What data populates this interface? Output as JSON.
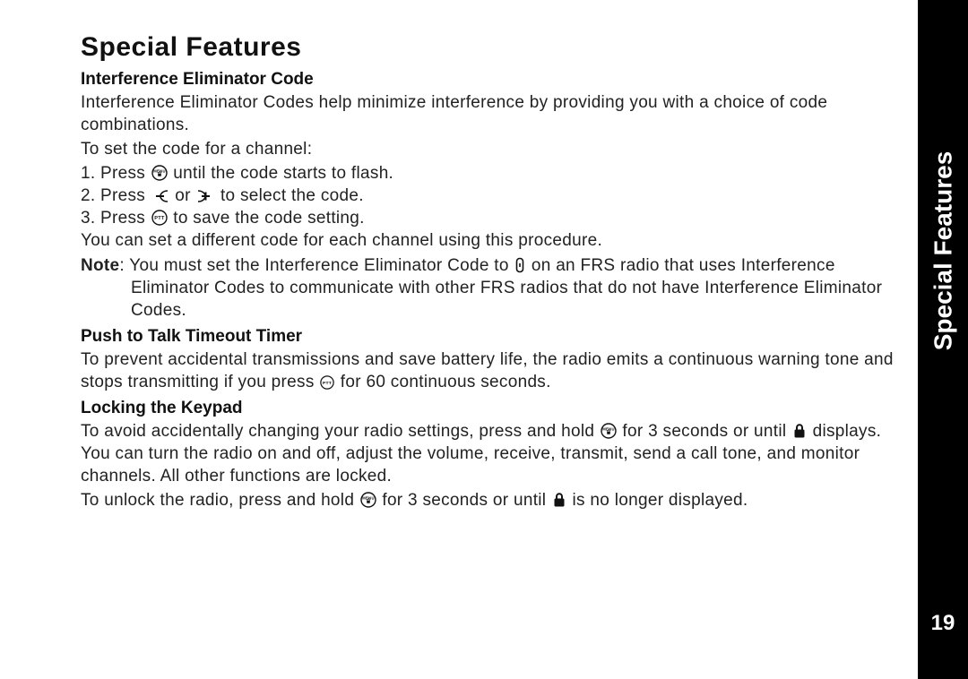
{
  "title": "Special Features",
  "side_tab": "Special Features",
  "page_number": "19",
  "interference": {
    "heading": "Interference Eliminator Code",
    "intro": "Interference Eliminator Codes help minimize interference by providing you with a choice of code combinations.",
    "setline": "To set the code for a channel:",
    "step1_a": "1. Press ",
    "step1_b": "until the code starts to flash.",
    "step2_a": "2. Press ",
    "step2_b": " or ",
    "step2_c": " to select the code.",
    "step3_a": "3. Press ",
    "step3_b": "to save the code setting.",
    "after": "You can set a different code for each channel using this procedure.",
    "note_label": "Note",
    "note_a": ": You must set the Interference Eliminator Code to ",
    "note_b": " on an FRS radio that uses Interference Eliminator Codes to communicate with other FRS radios that do not have Interference Eliminator Codes."
  },
  "ptt": {
    "heading": "Push to Talk Timeout Timer",
    "body_a": "To prevent accidental transmissions and save battery life, the radio emits a continuous warning tone and stops transmitting if you press ",
    "body_b": " for 60 continuous seconds."
  },
  "lock": {
    "heading": "Locking the Keypad",
    "p1_a": "To avoid accidentally changing your radio settings, press and hold ",
    "p1_b": " for 3 seconds or until ",
    "p1_c": " displays. You can turn the radio on and off, adjust the volume, receive, transmit, send a call tone, and monitor channels. All other functions are locked.",
    "p2_a": "To unlock the radio, press and hold ",
    "p2_b": " for 3 seconds or until ",
    "p2_c": " is no longer displayed."
  },
  "icons": {
    "menu_lock": "menu-lock-icon",
    "minus": "minus-icon",
    "plus": "plus-icon",
    "ptt": "ptt-icon",
    "zero": "zero-glyph-icon",
    "lock": "lock-icon"
  }
}
